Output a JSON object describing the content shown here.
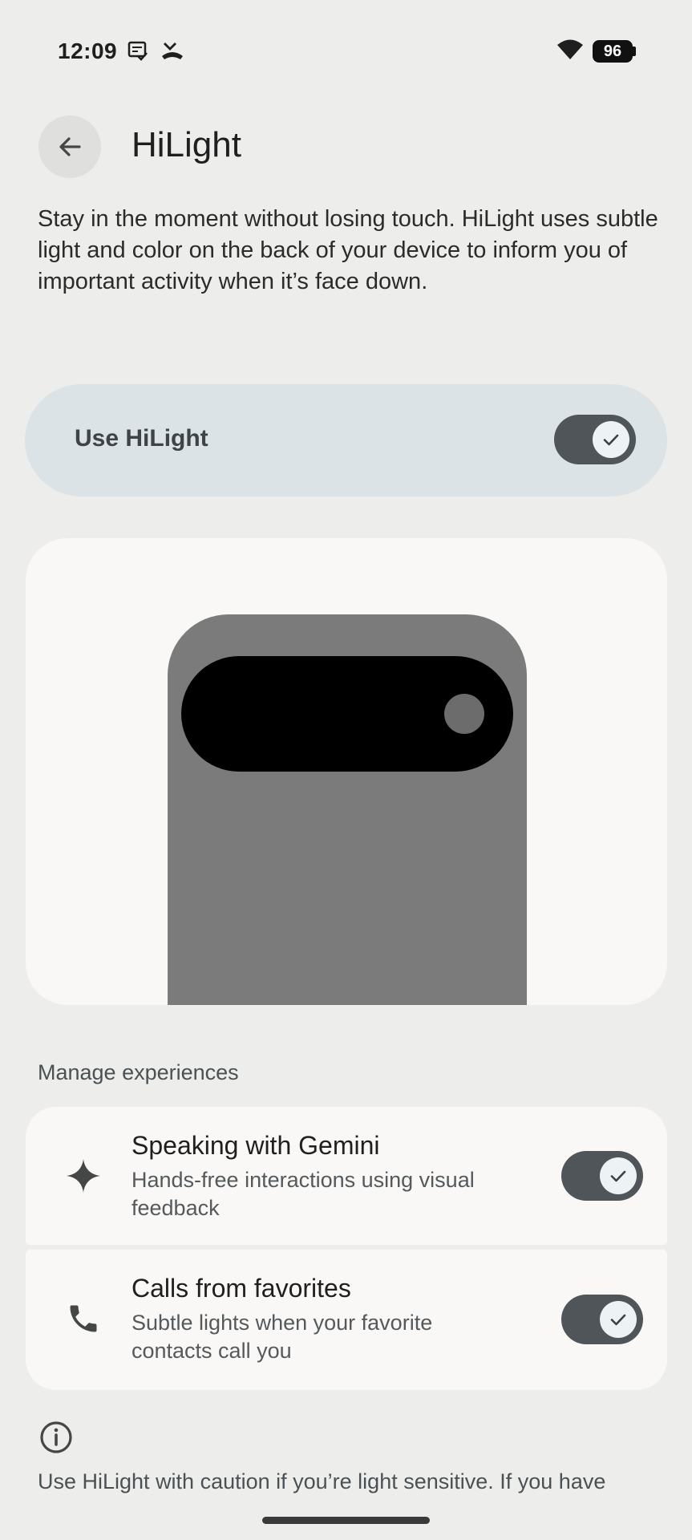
{
  "status_bar": {
    "time": "12:09",
    "battery": "96",
    "icons": [
      "notes-icon",
      "missed-call-icon",
      "wifi-icon",
      "battery-icon"
    ]
  },
  "header": {
    "title": "HiLight",
    "back_icon": "arrow-back-icon"
  },
  "description": "Stay in the moment without losing touch. HiLight uses subtle light and color on the back of your device to inform you of important activity when it’s face down.",
  "main_toggle": {
    "label": "Use HiLight",
    "checked": true
  },
  "preview": {
    "illustration": "phone-back-illustration"
  },
  "manage": {
    "header": "Manage experiences",
    "items": [
      {
        "icon": "sparkle-icon",
        "title": "Speaking with Gemini",
        "subtitle": "Hands-free interactions using visual feedback",
        "checked": true
      },
      {
        "icon": "phone-icon",
        "title": "Calls from favorites",
        "subtitle": "Subtle lights when your favorite contacts call you",
        "checked": true
      }
    ]
  },
  "footer": {
    "info_icon": "info-icon",
    "caution": "Use HiLight with caution if you’re light sensitive. If you have"
  },
  "colors": {
    "background": "#ededeb",
    "card": "#f9f8f6",
    "toggle_card": "#dce3e6",
    "switch_track": "#4f5558",
    "switch_thumb": "#edf3f5",
    "phone_body": "#7a7b7a"
  }
}
